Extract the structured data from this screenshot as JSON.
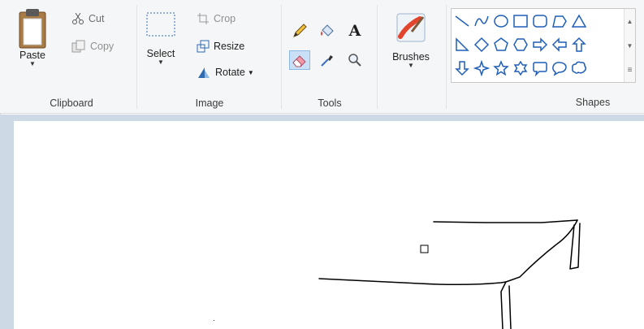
{
  "clipboard": {
    "label": "Clipboard",
    "paste": "Paste",
    "cut": "Cut",
    "copy": "Copy"
  },
  "image": {
    "label": "Image",
    "select": "Select",
    "crop": "Crop",
    "resize": "Resize",
    "rotate": "Rotate"
  },
  "tools": {
    "label": "Tools",
    "items": [
      "pencil-icon",
      "fill-icon",
      "text-icon",
      "eraser-icon",
      "color-picker-icon",
      "magnifier-icon"
    ],
    "selected": "eraser-icon"
  },
  "brushes": {
    "label": "Brushes"
  },
  "shapes": {
    "label": "Shapes",
    "row1": [
      "line",
      "curve",
      "oval",
      "rectangle",
      "rounded-rectangle",
      "polygon",
      "triangle"
    ],
    "row2": [
      "right-triangle",
      "diamond",
      "pentagon",
      "hexagon",
      "right-arrow",
      "left-arrow",
      "up-arrow"
    ],
    "row3": [
      "down-arrow",
      "four-point-star",
      "five-point-star",
      "six-point-star",
      "rounded-callout",
      "oval-callout",
      "cloud-callout"
    ]
  },
  "colors": {
    "accent": "#1f5fb8",
    "selected_bg": "#c9e0f7",
    "workspace": "#ced9e6"
  }
}
